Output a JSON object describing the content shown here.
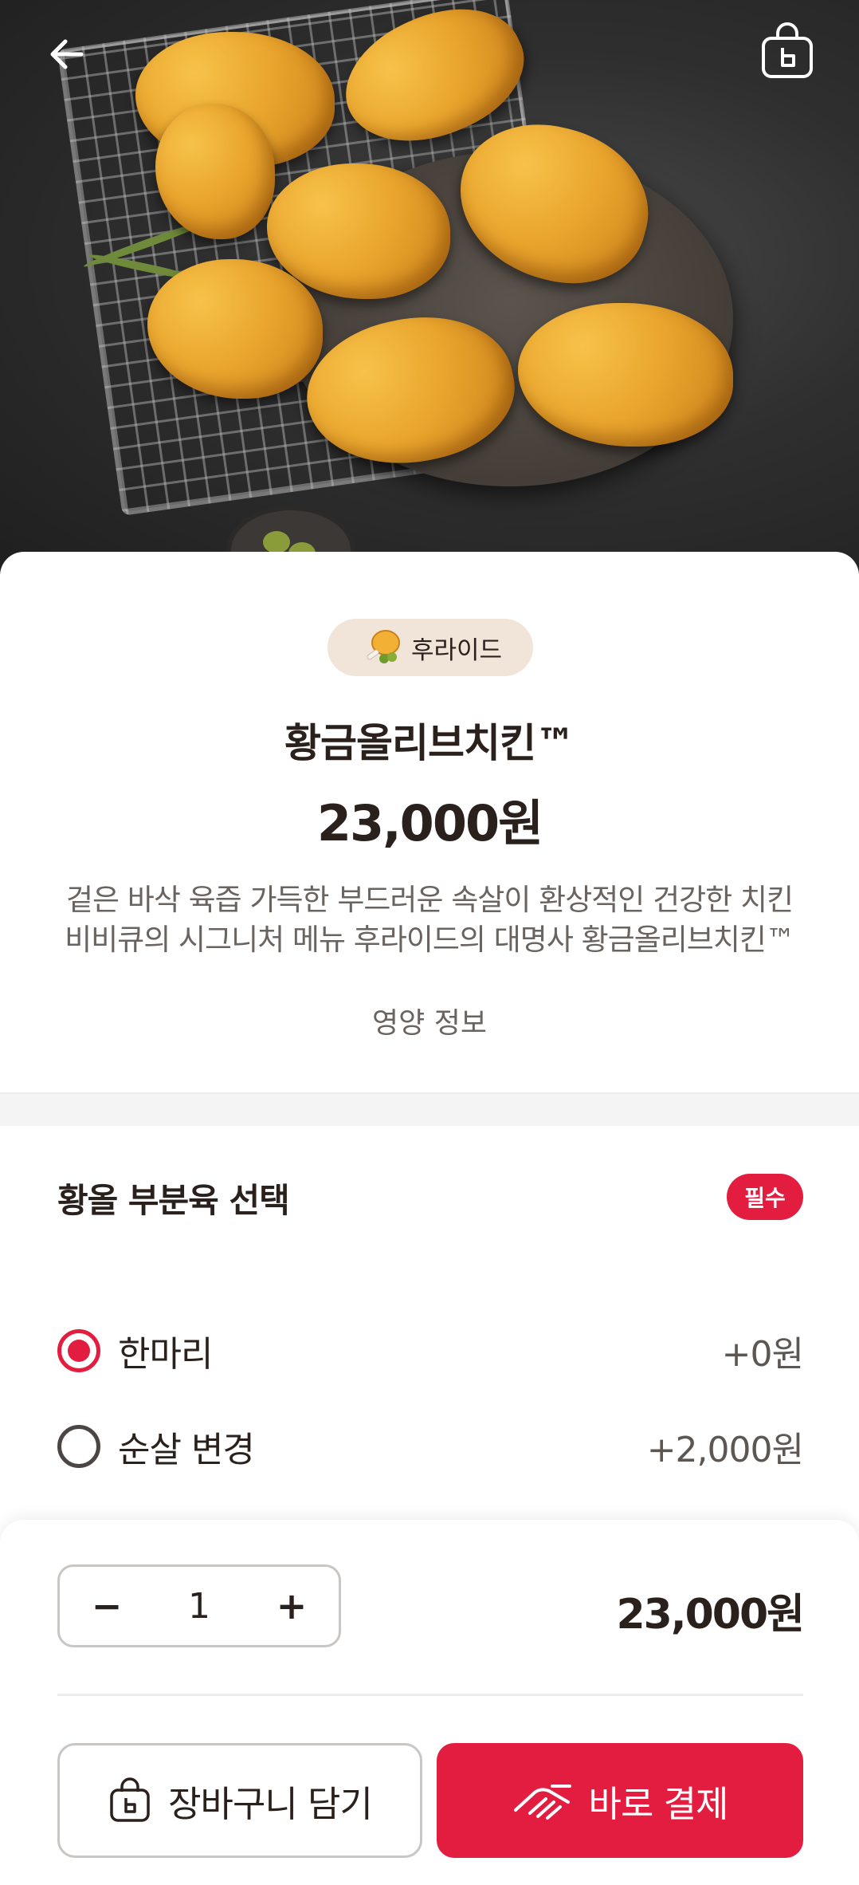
{
  "colors": {
    "accent": "#e31d3f",
    "text": "#2a211d",
    "muted": "#6a6461",
    "badge_bg": "#f1e4d9"
  },
  "header": {
    "back_icon": "arrow-left-icon",
    "cart_icon": "shopping-bag-icon"
  },
  "product": {
    "category_badge": "후라이드",
    "name": "황금올리브치킨™",
    "price": "23,000원",
    "description_line1": "겉은 바삭 육즙 가득한 부드러운 속살이 환상적인 건강한 치킨",
    "description_line2": "비비큐의 시그니처 메뉴 후라이드의 대명사 황금올리브치킨™",
    "nutrition_link": "영양 정보"
  },
  "option_group": {
    "title": "황올 부분육 선택",
    "required_label": "필수",
    "options": [
      {
        "label": "한마리",
        "price": "+0원",
        "selected": true
      },
      {
        "label": "순살 변경",
        "price": "+2,000원",
        "selected": false
      }
    ]
  },
  "order": {
    "minus": "−",
    "quantity": "1",
    "plus": "+",
    "total": "23,000원",
    "add_to_cart": "장바구니 담기",
    "buy_now": "바로 결제"
  }
}
